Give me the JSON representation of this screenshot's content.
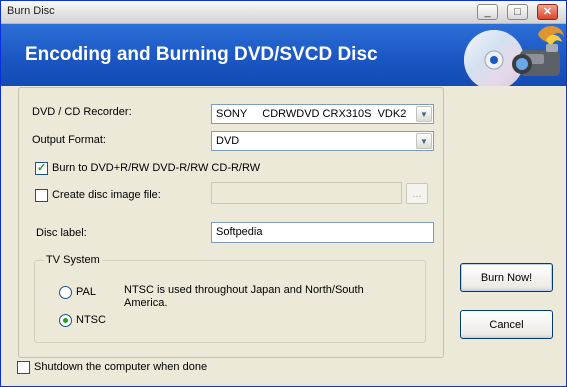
{
  "window": {
    "title": "Burn Disc",
    "controls": {
      "minimize": "_",
      "maximize": "□",
      "close": "✕"
    }
  },
  "banner": {
    "heading": "Encoding and Burning DVD/SVCD Disc",
    "art_icons": [
      "disc-icon",
      "camcorder-icon"
    ]
  },
  "form": {
    "recorder_label": "DVD / CD Recorder:",
    "recorder_value": "SONY     CDRWDVD CRX310S  VDK2",
    "output_format_label": "Output Format:",
    "output_format_value": "DVD",
    "burn_checkbox": {
      "label": "Burn to DVD+R/RW DVD-R/RW  CD-R/RW",
      "checked": true
    },
    "image_checkbox": {
      "label": "Create disc image file:",
      "checked": false
    },
    "image_path_value": "",
    "browse_label": "...",
    "disc_label_label": "Disc label:",
    "disc_label_value": "Softpedia"
  },
  "tv_system": {
    "legend": "TV System",
    "options": [
      {
        "label": "PAL",
        "selected": false
      },
      {
        "label": "NTSC",
        "selected": true
      }
    ],
    "description": "NTSC is used throughout Japan and North/South America."
  },
  "buttons": {
    "burn_now": "Burn Now!",
    "cancel": "Cancel"
  },
  "shutdown_checkbox": {
    "label": "Shutdown the computer when done",
    "checked": false
  },
  "colors": {
    "banner_blue": "#1b57c4",
    "check_green": "#21a121",
    "window_bg": "#ece9d8"
  }
}
